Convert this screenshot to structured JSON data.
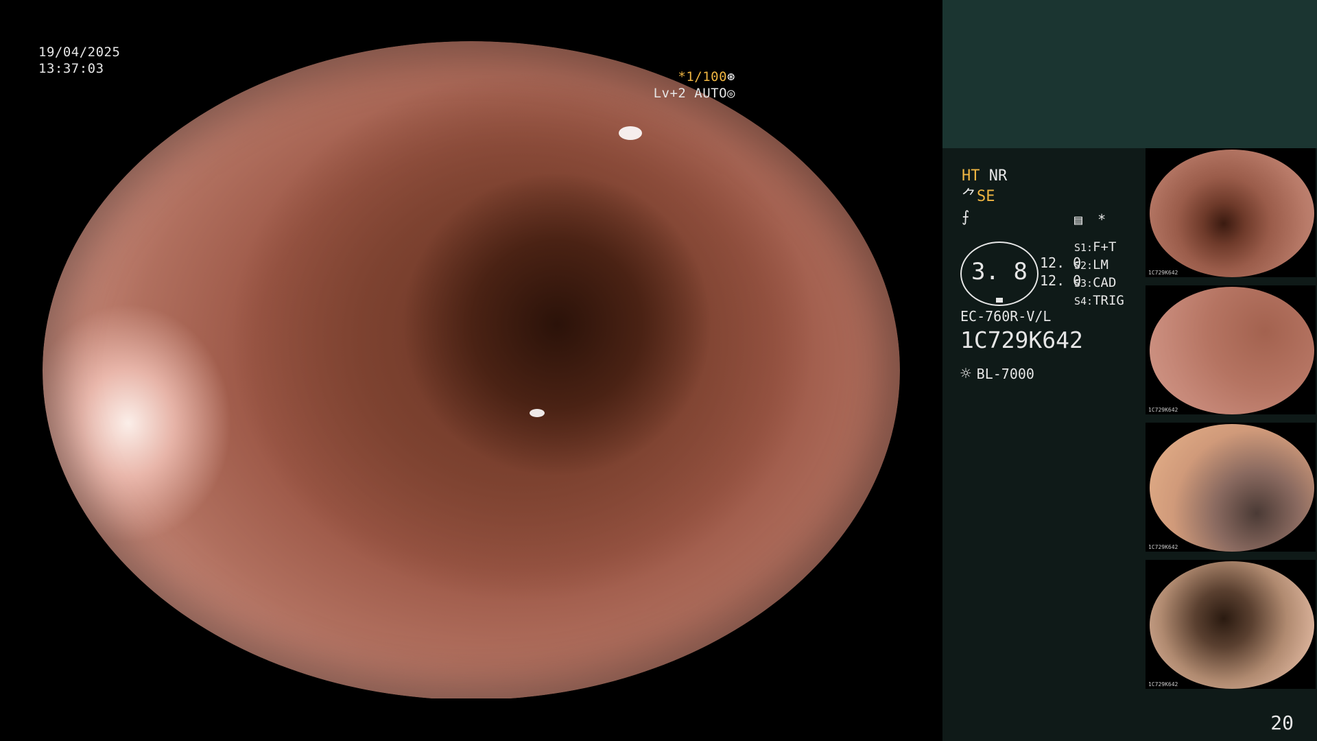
{
  "osd": {
    "date": "19/04/2025",
    "time": "13:37:03",
    "shutter": "*1/100",
    "shutter_icon": "⊛",
    "level": "Lv+2 AUTO",
    "level_icon": "◎"
  },
  "panel": {
    "mode_ht": "HT",
    "mode_nr": "NR",
    "mode_se_prefix": "⺈",
    "mode_se": "SE",
    "mode_sym": "⨍",
    "icon_menu": "▤",
    "icon_star": "*",
    "gauge_value": "3. 8",
    "gauge_side_1": "12. 0",
    "gauge_side_2": "12. 0",
    "switches": [
      {
        "key": "S1:",
        "value": "F+T"
      },
      {
        "key": "S2:",
        "value": "LM"
      },
      {
        "key": "S3:",
        "value": "CAD"
      },
      {
        "key": "S4:",
        "value": "TRIG"
      }
    ],
    "scope_model": "EC-760R-V/L",
    "scope_serial": "1C729K642",
    "light_icon": "☼",
    "light_source": "BL-7000",
    "page_number": "20"
  },
  "thumbnails": [
    {
      "label": "1C729K642"
    },
    {
      "label": "1C729K642"
    },
    {
      "label": "1C729K642"
    },
    {
      "label": "1C729K642"
    }
  ],
  "colors": {
    "accent": "#f0b642",
    "panel_bg": "#0f1a18",
    "panel_top": "#1b3531"
  }
}
